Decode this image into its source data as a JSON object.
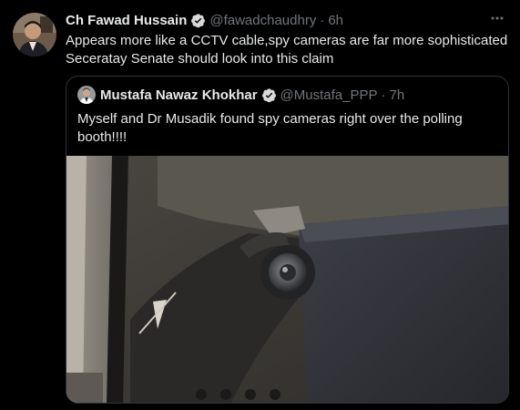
{
  "tweet": {
    "display_name": "Ch Fawad Hussain",
    "handle": "@fawadchaudhry",
    "separator": "·",
    "time": "6h",
    "text_lines": [
      "Appears more like a CCTV cable,spy cameras are far more sophisticated",
      "Seceratay Senate should look into this claim"
    ],
    "more_icon": "more-horizontal-icon",
    "verified_icon": "verified-badge-icon"
  },
  "quoted_tweet": {
    "display_name": "Mustafa Nawaz Khokhar",
    "handle": "@Mustafa_PPP",
    "separator": "·",
    "time": "7h",
    "text_lines": [
      "Myself and Dr Musadik found spy cameras right over the polling",
      "booth!!!!"
    ],
    "media": "photo of a small camera lens mounted on a bracket"
  },
  "colors": {
    "background": "#000000",
    "text_primary": "#e7e9ea",
    "text_secondary": "#71767b",
    "border": "#2f3336",
    "verified": "#d9d9d9"
  }
}
